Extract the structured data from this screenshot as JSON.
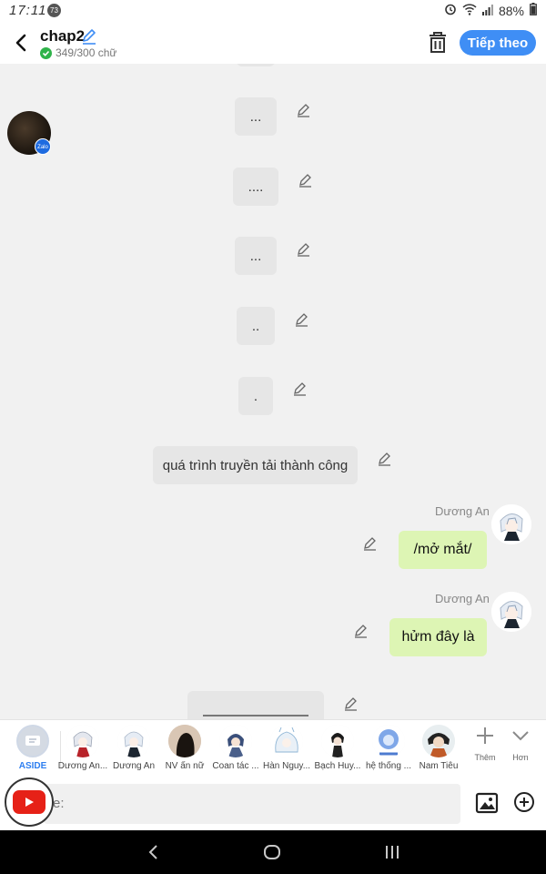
{
  "status_bar": {
    "time": "17:11",
    "notification_count": "73",
    "battery": "88%"
  },
  "header": {
    "title": "chap2",
    "word_count": "349/300 chữ",
    "next_label": "Tiếp theo"
  },
  "messages": [
    {
      "text": "...",
      "side": "left"
    },
    {
      "text": "....",
      "side": "left"
    },
    {
      "text": "...",
      "side": "left"
    },
    {
      "text": "..",
      "side": "left"
    },
    {
      "text": ".",
      "side": "left"
    },
    {
      "text": "quá trình truyền tải thành công",
      "side": "left"
    },
    {
      "text": "/mở mắt/",
      "side": "right",
      "sender": "Dương An"
    },
    {
      "text": "hửm đây là",
      "side": "right",
      "sender": "Dương An"
    },
    {
      "text": "",
      "side": "left"
    }
  ],
  "npc_badge": "Zalo",
  "characters": [
    {
      "name": "ASIDE"
    },
    {
      "name": "Dương An..."
    },
    {
      "name": "Dương An"
    },
    {
      "name": "NV ẩn nữ"
    },
    {
      "name": "Coan tác ..."
    },
    {
      "name": "Hàn Nguy..."
    },
    {
      "name": "Bạch Huy..."
    },
    {
      "name": "hệ thống ..."
    },
    {
      "name": "Nam Tiêu"
    }
  ],
  "tools": {
    "add_label": "Thêm",
    "more_label": "Hơn"
  },
  "input": {
    "placeholder": "e:"
  },
  "colors": {
    "accent": "#3f8ef5",
    "my_bubble": "#ddf5b4",
    "other_bubble": "#e6e6e6",
    "youtube": "#e62117"
  }
}
